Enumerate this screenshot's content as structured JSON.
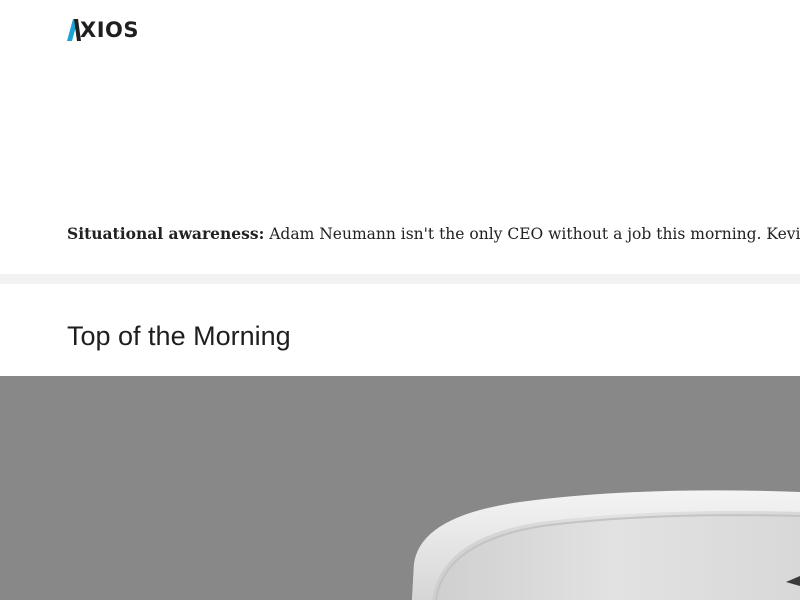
{
  "header": {
    "logo_text": "XIOS",
    "logo_alt": "AXIOS",
    "colors": {
      "logo_accent": "#1aa3d4",
      "logo_dark": "#1f1f1f"
    }
  },
  "intro": {
    "lead": "Situational awareness:",
    "text": " Adam Neumann isn't the only CEO without a job this morning. Kevin"
  },
  "section": {
    "title": "Top of the Morning"
  },
  "hero": {
    "subject": "coffee-cup-image",
    "background_color": "#888888"
  }
}
